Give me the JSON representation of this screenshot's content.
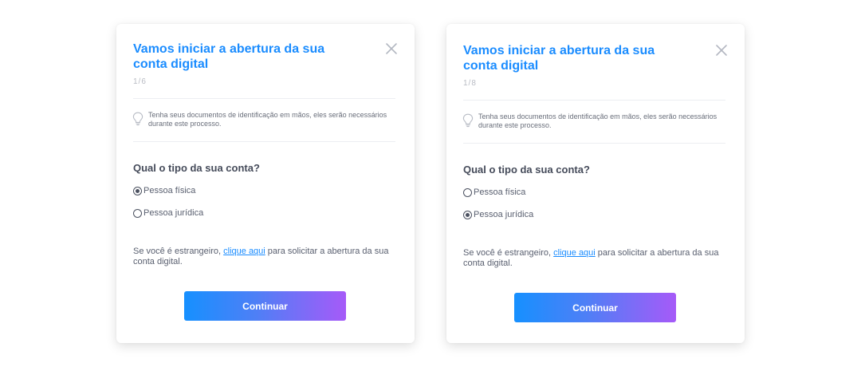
{
  "cards": [
    {
      "title": "Vamos iniciar a abertura da sua conta digital",
      "step": "1/6",
      "tip": "Tenha seus documentos de identificação em mãos, eles serão necessários durante este processo.",
      "question": "Qual o tipo da sua conta?",
      "options": [
        {
          "label": "Pessoa física",
          "checked": true
        },
        {
          "label": "Pessoa jurídica",
          "checked": false
        }
      ],
      "foreign_prefix": "Se você é estrangeiro,",
      "foreign_link": "clique aqui",
      "foreign_suffix": "para solicitar a abertura da sua conta digital.",
      "button": "Continuar"
    },
    {
      "title": "Vamos iniciar a abertura da sua conta digital",
      "step": "1/8",
      "tip": "Tenha seus documentos de identificação em mãos, eles serão necessários durante este processo.",
      "question": "Qual o tipo da sua conta?",
      "options": [
        {
          "label": "Pessoa física",
          "checked": false
        },
        {
          "label": "Pessoa jurídica",
          "checked": true
        }
      ],
      "foreign_prefix": "Se você é estrangeiro,",
      "foreign_link": "clique aqui",
      "foreign_suffix": "para solicitar a abertura da sua conta digital.",
      "button": "Continuar"
    }
  ],
  "colors": {
    "title": "#1a8cff",
    "link": "#1a8cff",
    "button_gradient_start": "#1690ff",
    "button_gradient_end": "#a65af8"
  },
  "icons": {
    "close": "close-icon",
    "tip": "lightbulb-icon"
  }
}
